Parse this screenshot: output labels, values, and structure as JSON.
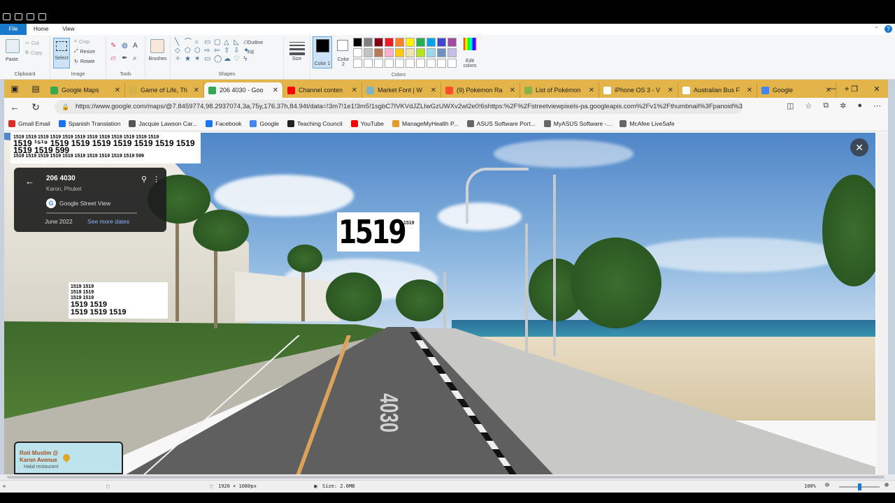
{
  "paint": {
    "ribbon_tabs": [
      "File",
      "Home",
      "View"
    ],
    "clipboard": {
      "paste": "Paste",
      "cut": "Cut",
      "copy": "Copy",
      "label": "Clipboard"
    },
    "image": {
      "select": "Select",
      "crop": "Crop",
      "resize": "Resize",
      "rotate": "Rotate",
      "label": "Image"
    },
    "tools": {
      "label": "Tools"
    },
    "brushes": {
      "label": "Brushes"
    },
    "shapes": {
      "outline": "Outline",
      "fill": "Fill",
      "label": "Shapes"
    },
    "size": {
      "label": "Size"
    },
    "color1": {
      "label": "Color 1",
      "value": "#000000"
    },
    "color2": {
      "label": "Color 2",
      "value": "#ffffff"
    },
    "colors": {
      "label": "Colors",
      "edit": "Edit colors"
    },
    "palette": [
      "#000000",
      "#7f7f7f",
      "#880015",
      "#ed1c24",
      "#ff7f27",
      "#fff200",
      "#22b14c",
      "#00a2e8",
      "#3f48cc",
      "#a349a4",
      "#ffffff",
      "#c3c3c3",
      "#b97a57",
      "#ffaec9",
      "#ffc90e",
      "#efe4b0",
      "#b5e61d",
      "#99d9ea",
      "#7092be",
      "#c8bfe7",
      "#ffffff",
      "#ffffff",
      "#ffffff",
      "#ffffff",
      "#ffffff",
      "#ffffff",
      "#ffffff",
      "#ffffff",
      "#ffffff",
      "#ffffff"
    ],
    "status": {
      "dimensions": "1920 × 1080px",
      "size": "Size: 2.6MB",
      "zoom": "100%",
      "zoom_fraction": 0.5
    }
  },
  "browser": {
    "tabs": [
      {
        "title": "Google Maps",
        "color": "#34a853"
      },
      {
        "title": "Game of Life, Th",
        "color": "#d4b24a"
      },
      {
        "title": "206 4030 - Goo",
        "color": "#34a853",
        "active": true
      },
      {
        "title": "Channel conten",
        "color": "#ff0000"
      },
      {
        "title": "Market Font | W",
        "color": "#7fb3c8"
      },
      {
        "title": "(9) Pokemon Ra",
        "color": "#ff4e2a"
      },
      {
        "title": "List of Pokémon",
        "color": "#8ab04a"
      },
      {
        "title": "iPhone OS 3 - V",
        "color": "#ffffff"
      },
      {
        "title": "Australian Bus F",
        "color": "#ffffff"
      },
      {
        "title": "Google",
        "color": "#4285f4"
      }
    ],
    "url": "https://www.google.com/maps/@7.8459774,98.2937074,3a,75y,176.37h,84.94t/data=!3m7!1e1!3m5!1sgbC7IVKVdJZLIwGzUWXv2wl2e0!6shttps:%2F%2Fstreetviewpixels-pa.googleapis.com%2Fv1%2Fthumbnail%3Fpanoid%3DgbC7IVKVdJZLIwGzUWXv2w",
    "bookmarks": [
      {
        "label": "Gmail Email",
        "color": "#d93025"
      },
      {
        "label": "Spanish Translation",
        "color": "#1a73e8"
      },
      {
        "label": "Jacquie Lawson Car...",
        "color": "#555555"
      },
      {
        "label": "Facebook",
        "color": "#1877f2"
      },
      {
        "label": "Google",
        "color": "#4285f4"
      },
      {
        "label": "Teaching Council",
        "color": "#222222"
      },
      {
        "label": "YouTube",
        "color": "#ff0000"
      },
      {
        "label": "ManageMyHealth P...",
        "color": "#e59b2a"
      },
      {
        "label": "ASUS Software Port...",
        "color": "#666666"
      },
      {
        "label": "MyASUS Software -...",
        "color": "#666666"
      },
      {
        "label": "McAfee LiveSafe",
        "color": "#666666"
      }
    ]
  },
  "streetview": {
    "title": "206 4030",
    "subtitle": "Karon, Phuket",
    "source": "Google Street View",
    "date": "June 2022",
    "see_more": "See more dates",
    "road_marking": "4030",
    "overlay_big": "1519",
    "overlay_small": "1519",
    "overlay_top_lines": [
      "1519 1519 1519 1519 1519 1519 1519 1519 1519 1519 1519 1519",
      "1519 ¹⁵¹⁹ 1519 1519 1519 1519 1519 1519 1519 1519 1519 599",
      "1519 1519 1519 1519 1519 1519 1519 1519 1519 1519 599"
    ],
    "overlay_left_lines": [
      "1519 1519",
      "1519 1519",
      "1519 1519",
      "1519 1519",
      "1519 1519 1519"
    ],
    "minimap": {
      "place": "Roti Muslim @",
      "place2": "Karon Avenue",
      "type": "Halal restaurant"
    }
  }
}
